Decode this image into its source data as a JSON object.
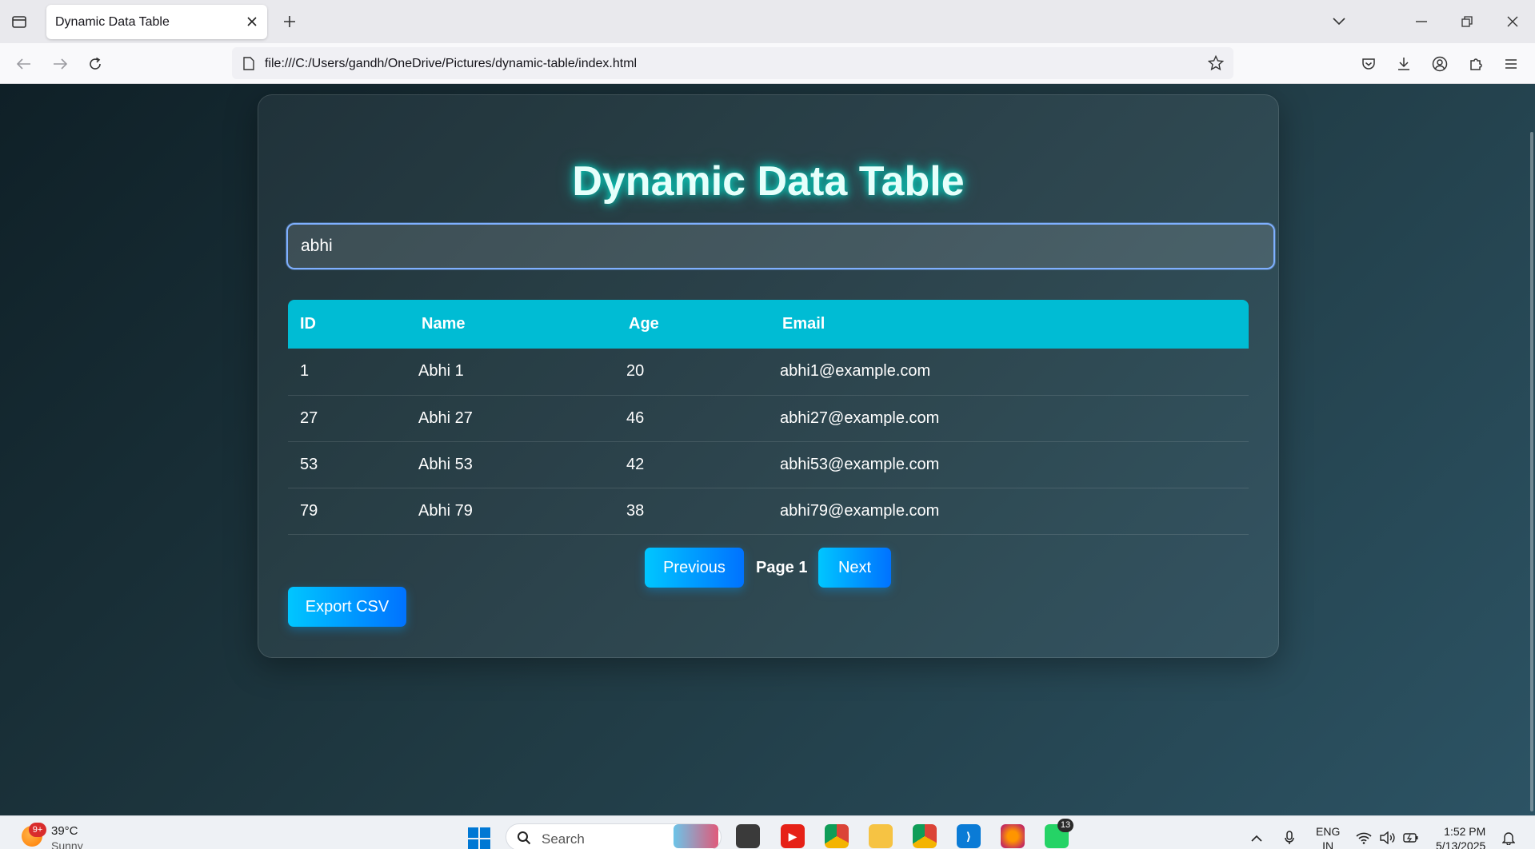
{
  "browser": {
    "tab_title": "Dynamic Data Table",
    "url": "file:///C:/Users/gandh/OneDrive/Pictures/dynamic-table/index.html"
  },
  "page": {
    "title": "Dynamic Data Table",
    "search": {
      "value": "abhi"
    },
    "table": {
      "headers": {
        "id": "ID",
        "name": "Name",
        "age": "Age",
        "email": "Email"
      },
      "rows": [
        {
          "id": "1",
          "name": "Abhi 1",
          "age": "20",
          "email": "abhi1@example.com"
        },
        {
          "id": "27",
          "name": "Abhi 27",
          "age": "46",
          "email": "abhi27@example.com"
        },
        {
          "id": "53",
          "name": "Abhi 53",
          "age": "42",
          "email": "abhi53@example.com"
        },
        {
          "id": "79",
          "name": "Abhi 79",
          "age": "38",
          "email": "abhi79@example.com"
        }
      ]
    },
    "pagination": {
      "prev_label": "Previous",
      "page_label": "Page 1",
      "next_label": "Next"
    },
    "export_label": "Export CSV"
  },
  "taskbar": {
    "weather": {
      "badge": "9+",
      "temp": "39°C",
      "condition": "Sunny"
    },
    "search_placeholder": "Search",
    "whatsapp_badge": "13",
    "lang_line1": "ENG",
    "lang_line2": "IN",
    "time": "1:52 PM",
    "date": "5/13/2025"
  },
  "colors": {
    "header_bg": "#00bcd4",
    "button_gradient_start": "#00c6ff",
    "button_gradient_end": "#0072ff",
    "title_glow": "#00e5d0"
  }
}
